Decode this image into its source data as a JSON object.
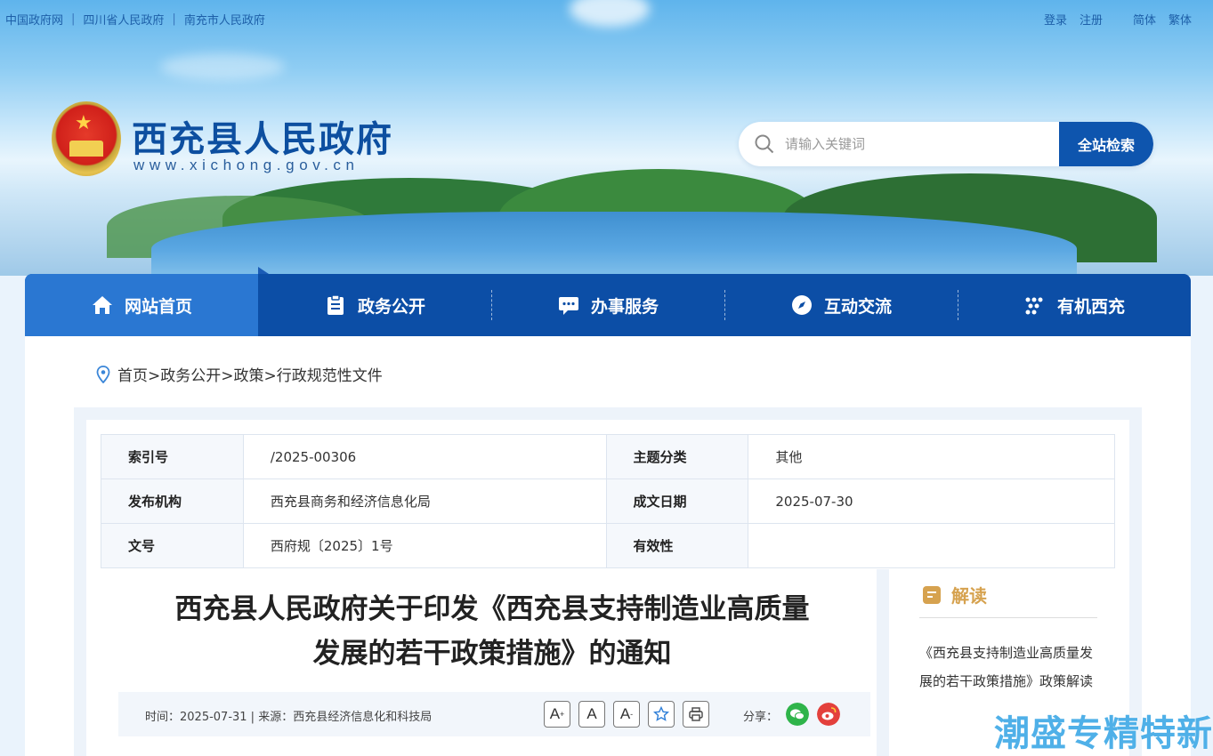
{
  "header": {
    "gov_links": [
      "中国政府网",
      "四川省人民政府",
      "南充市人民政府"
    ],
    "user_links": {
      "login": "登录",
      "register": "注册",
      "simplified": "简体",
      "traditional": "繁体"
    },
    "site_title": "西充县人民政府",
    "site_url": "www.xichong.gov.cn",
    "search": {
      "placeholder": "请输入关键词",
      "button": "全站检索"
    }
  },
  "nav": [
    {
      "label": "网站首页",
      "icon": "home-icon"
    },
    {
      "label": "政务公开",
      "icon": "clipboard-icon"
    },
    {
      "label": "办事服务",
      "icon": "chat-icon"
    },
    {
      "label": "互动交流",
      "icon": "compass-icon"
    },
    {
      "label": "有机西充",
      "icon": "grid-dots-icon"
    }
  ],
  "breadcrumb": "首页>政务公开>政策>行政规范性文件",
  "meta": {
    "index_label": "索引号",
    "index_value": "/2025-00306",
    "topic_label": "主题分类",
    "topic_value": "其他",
    "org_label": "发布机构",
    "org_value": "西充县商务和经济信息化局",
    "date_label": "成文日期",
    "date_value": "2025-07-30",
    "doc_label": "文号",
    "doc_value": "西府规〔2025〕1号",
    "valid_label": "有效性",
    "valid_value": ""
  },
  "article": {
    "title_line1": "西充县人民政府关于印发《西充县支持制造业高质量",
    "title_line2": "发展的若干政策措施》的通知",
    "info": "时间：2025-07-31 | 来源：西充县经济信息化和科技局",
    "tools": {
      "font_larger": "A",
      "font_normal": "A",
      "font_smaller": "A"
    },
    "share_label": "分享："
  },
  "side": {
    "heading": "解读",
    "link": "《西充县支持制造业高质量发展的若干政策措施》政策解读"
  },
  "watermark": "潮盛专精特新",
  "colors": {
    "nav": "#0c4ea6",
    "nav_active": "#2a77d2",
    "accent_gold": "#d6a24f",
    "title_blue": "#0d4fa0"
  }
}
